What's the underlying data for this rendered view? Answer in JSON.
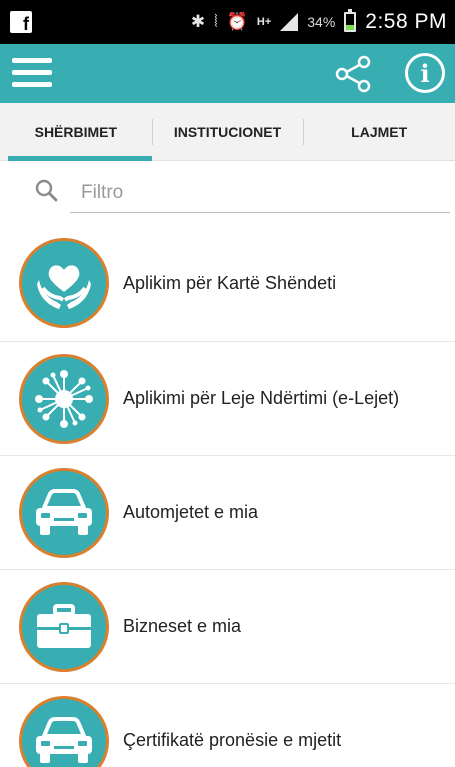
{
  "status_bar": {
    "battery_percent": "34%",
    "battery_level": 0.34,
    "time": "2:58 PM",
    "network": "H+"
  },
  "app_bar": {
    "background": "#38aeb3",
    "icons": [
      "menu-icon",
      "share-icon",
      "info-icon"
    ]
  },
  "tabs": [
    {
      "label": "SHËRBIMET",
      "active": true
    },
    {
      "label": "INSTITUCIONET",
      "active": false
    },
    {
      "label": "LAJMET",
      "active": false
    }
  ],
  "filter": {
    "placeholder": "Filtro",
    "value": ""
  },
  "services": [
    {
      "label": "Aplikim për Kartë Shëndeti",
      "icon": "health-hands-heart-icon"
    },
    {
      "label": "Aplikimi për Leje Ndërtimi (e-Lejet)",
      "icon": "network-hub-icon"
    },
    {
      "label": "Automjetet e mia",
      "icon": "car-icon"
    },
    {
      "label": "Bizneset e mia",
      "icon": "briefcase-icon"
    },
    {
      "label": "Çertifikatë pronësie e mjetit",
      "icon": "car-icon"
    }
  ],
  "colors": {
    "accent": "#38aeb3",
    "icon_ring": "#d9802e"
  }
}
